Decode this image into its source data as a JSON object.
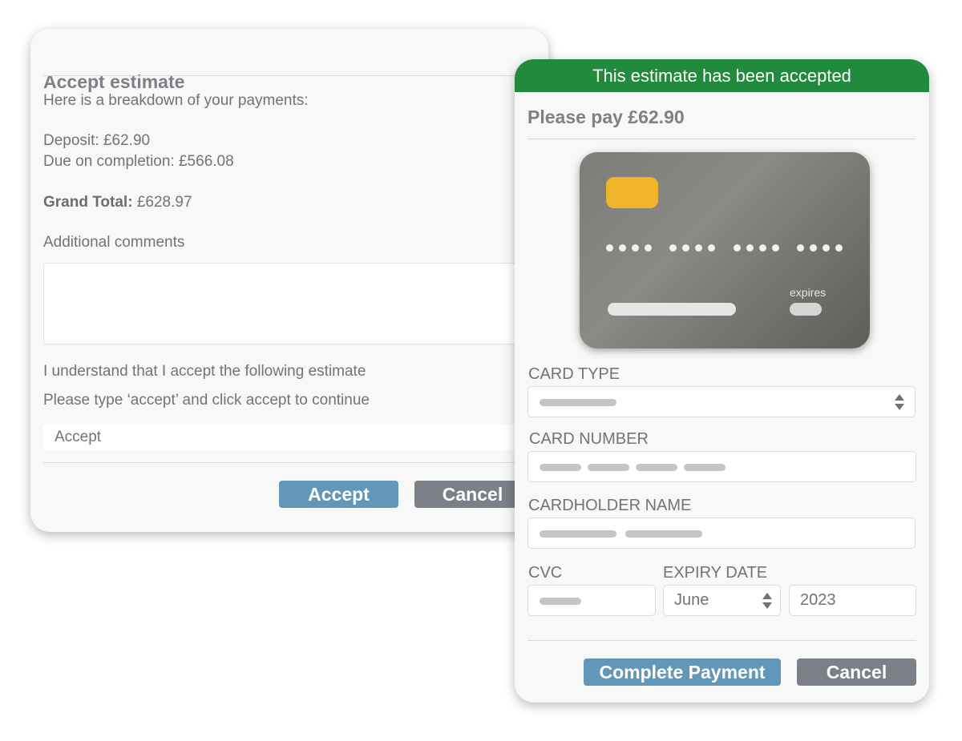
{
  "accept_modal": {
    "title": "Accept estimate",
    "intro": "Here is a breakdown of your payments:",
    "deposit": "Deposit: £62.90",
    "due_on_completion": "Due on completion: £566.08",
    "grand_total_label": "Grand Total:",
    "grand_total_value": " £628.97",
    "comments_label": "Additional comments",
    "comments_value": "",
    "understand_text": "I understand that I accept the following estimate",
    "type_instruction": "Please type ‘accept’ and click accept to continue",
    "accept_input_value": "Accept",
    "accept_button": "Accept",
    "cancel_button": "Cancel"
  },
  "payment_modal": {
    "banner": "This estimate has been accepted",
    "title": "Please pay £62.90",
    "card_preview": {
      "expires_label": "expires"
    },
    "fields": {
      "card_type_label": "CARD TYPE",
      "card_number_label": "CARD NUMBER",
      "cardholder_name_label": "CARDHOLDER NAME",
      "cvc_label": "CVC",
      "expiry_date_label": "EXPIRY DATE",
      "expiry_month": "June",
      "expiry_year": "2023"
    },
    "complete_button": "Complete Payment",
    "cancel_button": "Cancel"
  },
  "colors": {
    "banner_green": "#218a3c",
    "primary_button": "#6297b9",
    "secondary_button": "#7a8086",
    "card_chip": "#efb42a"
  },
  "icons": [
    "select-arrows-icon",
    "card-chip-icon"
  ]
}
